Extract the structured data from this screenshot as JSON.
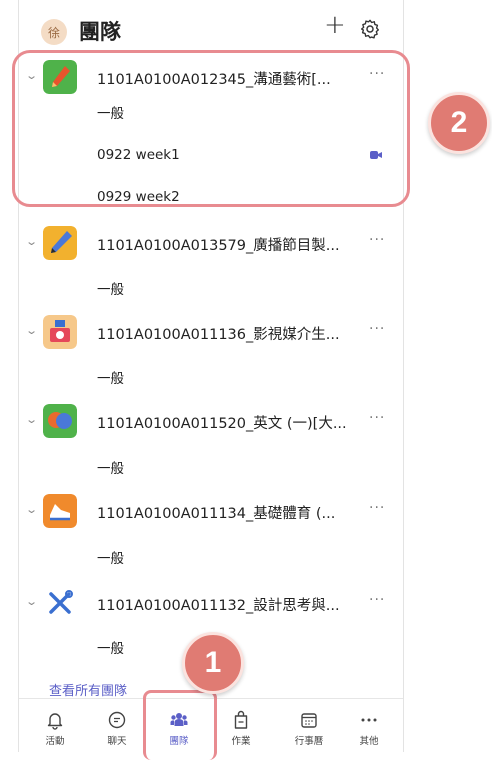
{
  "header": {
    "avatar_text": "徐",
    "title": "團隊"
  },
  "teams": [
    {
      "name": "1101A0100A012345_溝通藝術[...",
      "icon": "pen-nib-icon",
      "color": "#4fb24a",
      "channels": [
        "一般",
        "0922 week1",
        "0929 week2"
      ]
    },
    {
      "name": "1101A0100A013579_廣播節目製...",
      "icon": "pencil-icon",
      "color": "#f2b12e",
      "channels": [
        "一般"
      ]
    },
    {
      "name": "1101A0100A011136_影視媒介生...",
      "icon": "camera-icon",
      "color": "#f6c88a",
      "channels": [
        "一般"
      ]
    },
    {
      "name": "1101A0100A011520_英文 (一)[大...",
      "icon": "speech-bubbles-icon",
      "color": "#4fb24a",
      "channels": [
        "一般"
      ]
    },
    {
      "name": "1101A0100A011134_基礎體育 (...",
      "icon": "sneaker-icon",
      "color": "#f08a2c",
      "channels": [
        "一般"
      ]
    },
    {
      "name": "1101A0100A011132_設計思考與...",
      "icon": "tools-icon",
      "color": "#ffffff",
      "channels": [
        "一般"
      ]
    }
  ],
  "more_label": "···",
  "view_all": "查看所有團隊",
  "tabs": [
    {
      "label": "活動",
      "icon": "bell-icon"
    },
    {
      "label": "聊天",
      "icon": "chat-icon"
    },
    {
      "label": "團隊",
      "icon": "teams-icon",
      "active": true
    },
    {
      "label": "作業",
      "icon": "assignment-icon"
    },
    {
      "label": "行事曆",
      "icon": "calendar-icon"
    },
    {
      "label": "其他",
      "icon": "more-icon"
    }
  ],
  "callouts": {
    "one": "1",
    "two": "2"
  }
}
